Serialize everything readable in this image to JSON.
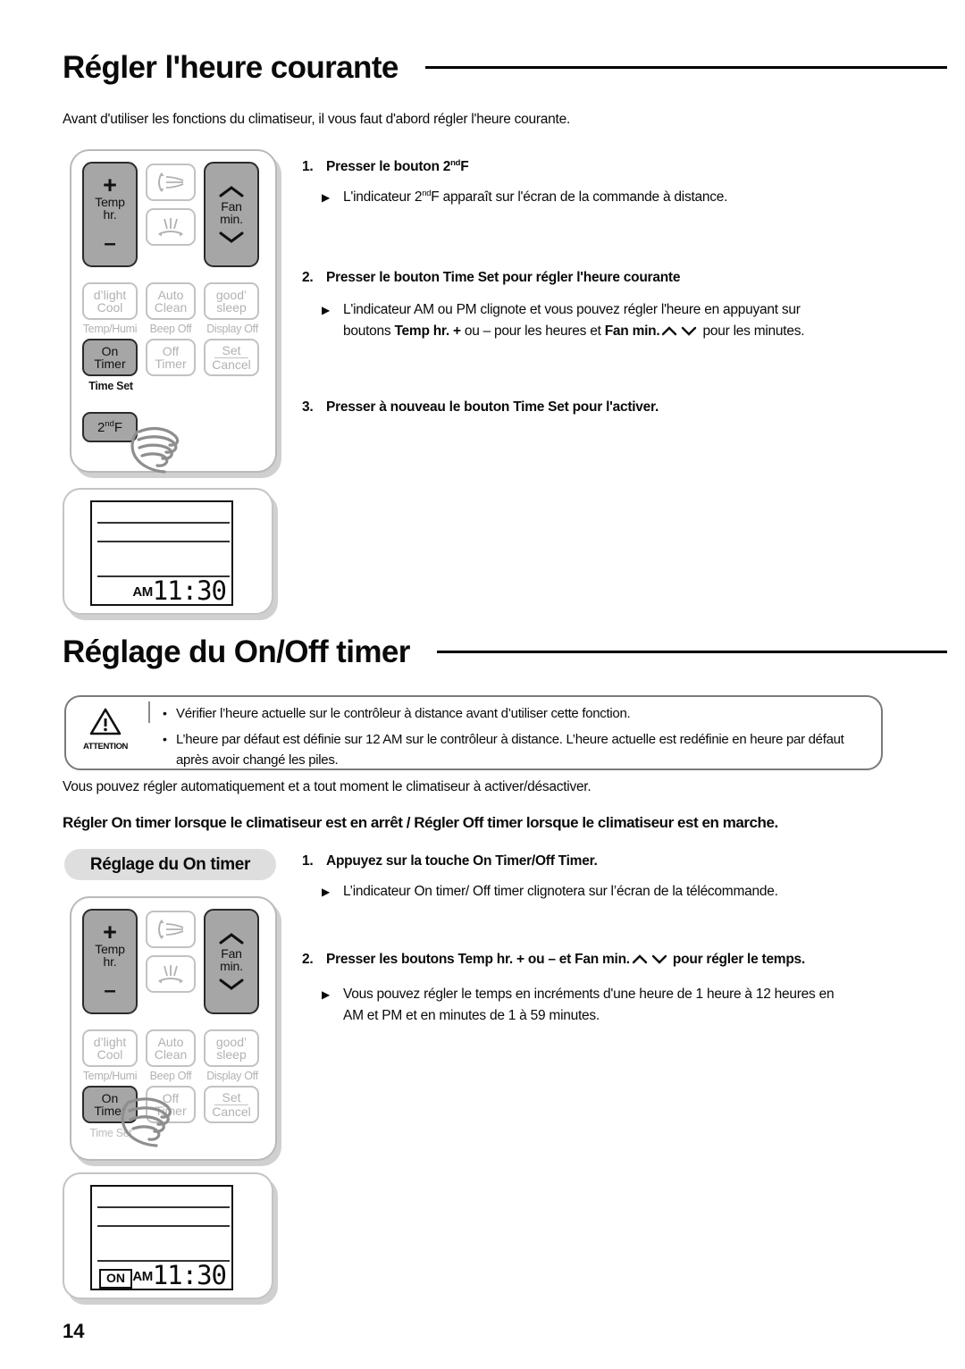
{
  "section1": {
    "heading": "Régler l'heure courante",
    "intro": "Avant d'utiliser les fonctions du climatiseur, il vous faut d'abord régler l'heure courante.",
    "steps": [
      {
        "num": "1.",
        "head_pre": "Presser le bouton ",
        "head_bold": "2",
        "head_sup": "nd",
        "head_post": "F",
        "bullets": [
          {
            "pre": "L'indicateur 2",
            "sup": "nd",
            "post": "F apparaît sur l'écran de la commande à distance."
          }
        ]
      },
      {
        "num": "2.",
        "head": "Presser le bouton Time Set pour régler l'heure courante",
        "bullets": [
          {
            "text": "L'indicateur AM ou PM clignote et vous pouvez régler l'heure en appuyant sur boutons Temp hr. + ou – pour les heures et Fan min. ⌃ ⌄ pour les minutes."
          }
        ]
      },
      {
        "num": "3.",
        "head": "Presser à nouveau le bouton Time Set pour l'activer.",
        "bullets": []
      }
    ]
  },
  "section2": {
    "heading": "Réglage du On/Off timer",
    "attention": {
      "label": "ATTENTION",
      "icon": "warning-triangle-icon",
      "lines": [
        "Vérifier l’heure actuelle sur le contrôleur à distance avant d’utiliser cette fonction.",
        "L’heure par défaut est définie sur 12 AM sur le contrôleur à distance. L’heure actuelle est redéfinie en heure par défaut après avoir changé les piles."
      ]
    },
    "para": "Vous pouvez régler automatiquement et a tout moment le climatiseur à activer/désactiver.",
    "bold_para": "Régler On timer  lorsque le climatiseur est en arrêt / Régler Off timer lorsque le climatiseur est en marche.",
    "pill": "Réglage du On timer",
    "steps": [
      {
        "num": "1.",
        "head": "Appuyez sur la touche On Timer/Off Timer.",
        "bullets": [
          {
            "text": "L’indicateur On timer/ Off timer clignotera sur l’écran de la télécommande."
          }
        ]
      },
      {
        "num": "2.",
        "head": "Presser les boutons Temp hr. + ou – et Fan min. ⌃ ⌄  pour régler le temps.",
        "bullets": [
          {
            "text": "Vous pouvez régler le temps en incréments d'une heure de 1 heure à 12 heures en AM et PM et en minutes de 1 à 59 minutes."
          }
        ]
      }
    ]
  },
  "remote": {
    "temp_label_1": "Temp",
    "temp_label_2": "hr.",
    "plus": "+",
    "minus": "–",
    "fan_label_1": "Fan",
    "fan_label_2": "min.",
    "swing_vertical_icon": "vertical-swing-icon",
    "swing_horizontal_icon": "horizontal-swing-icon",
    "buttons": [
      {
        "l1": "d’light",
        "l2": "Cool",
        "sub": "Temp/Humi"
      },
      {
        "l1": "Auto",
        "l2": "Clean",
        "sub": "Beep Off"
      },
      {
        "l1": "good’",
        "l2": "sleep",
        "sub": "Display Off"
      }
    ],
    "timer_row": [
      {
        "l1": "On",
        "l2": "Timer",
        "sub": "Time Set"
      },
      {
        "l1": "Off",
        "l2": "Timer",
        "sub": ""
      },
      {
        "l1": "Set",
        "l2": "Cancel",
        "sub": ""
      }
    ],
    "second_f": "2ⁿᵈF",
    "second_f_main": "2",
    "second_f_sup": "nd",
    "second_f_tail": "F",
    "hand_icon": "pointing-hand-icon"
  },
  "lcd_top": {
    "ampm": "AM",
    "time": "11:30",
    "on_badge": ""
  },
  "lcd_bottom": {
    "ampm": "AM",
    "time": "11:30",
    "on_badge": "ON"
  },
  "footer": {
    "page_number": "14"
  },
  "colors": {
    "button_dark": "#a6a6a6",
    "button_border_dark": "#2b2b2b",
    "button_light_border": "#c2c2c2",
    "muted_text": "#b2b2b2",
    "pill_bg": "#dedede",
    "rule": "#000000"
  }
}
